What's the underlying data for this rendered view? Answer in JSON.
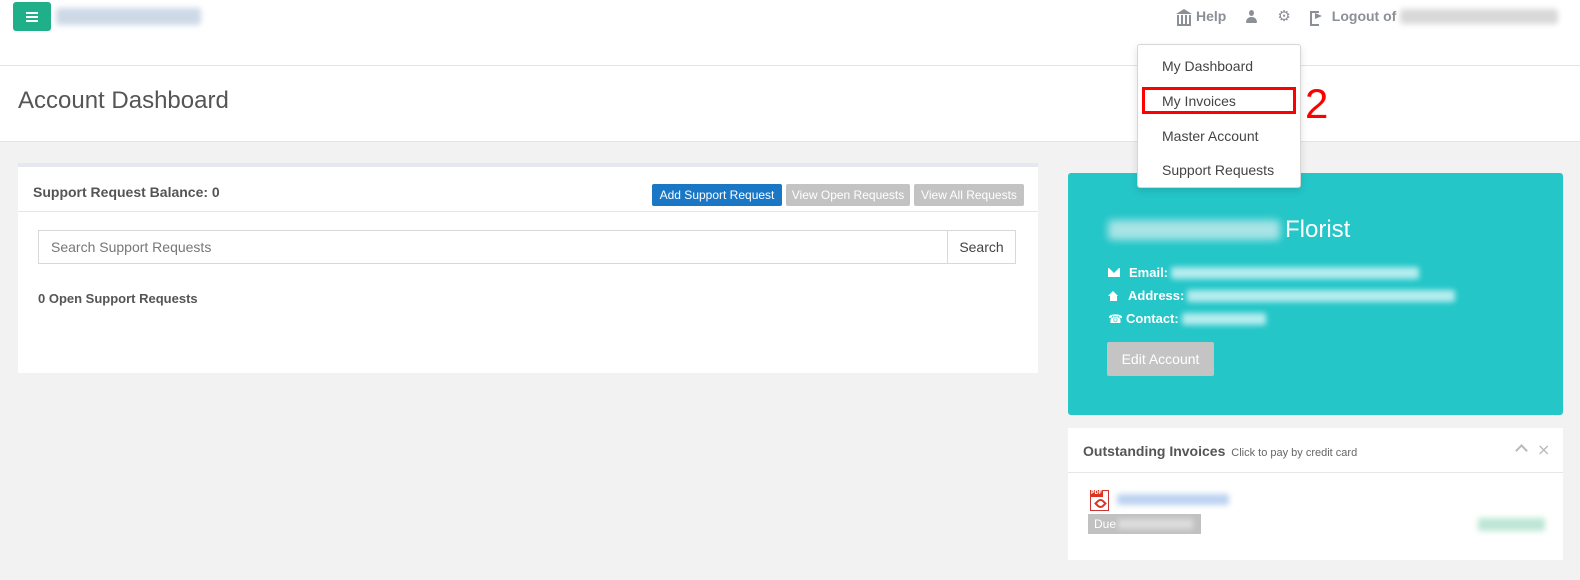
{
  "navbar": {
    "help_label": "Help",
    "logout_label": "Logout of",
    "icons": [
      "menu-icon",
      "bank-icon",
      "user-icon",
      "gear-icon",
      "logout-icon"
    ]
  },
  "page": {
    "title": "Account Dashboard"
  },
  "dropdown": {
    "items": [
      "My Dashboard",
      "My Invoices",
      "Master Account",
      "Support Requests"
    ]
  },
  "annotation": {
    "step_number": "2",
    "color": "#ff0000"
  },
  "support": {
    "balance_title": "Support Request Balance: 0",
    "add_button": "Add Support Request",
    "view_open_button": "View Open Requests",
    "view_all_button": "View All Requests",
    "search_placeholder": "Search Support Requests",
    "search_button": "Search",
    "open_count_text": "0 Open Support Requests"
  },
  "account": {
    "name_suffix": "Florist",
    "email_label": "Email:",
    "address_label": "Address:",
    "contact_label": "Contact:",
    "edit_button": "Edit Account",
    "card_color": "#24c6c8"
  },
  "invoices": {
    "title": "Outstanding Invoices",
    "subtitle": "Click to pay by credit card",
    "due_prefix": "Due",
    "pdf_label": "PDF"
  },
  "colors": {
    "primary": "#1977c5",
    "menu_button": "#1fb08a",
    "disabled_button": "#c3c3c3"
  }
}
